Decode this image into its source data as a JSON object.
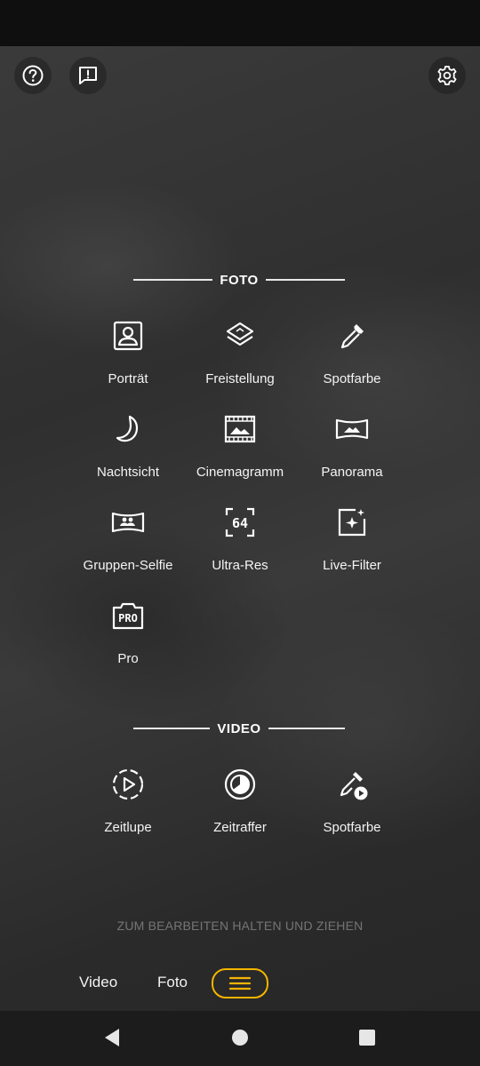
{
  "colors": {
    "accent": "#f5b400",
    "text": "#ffffff",
    "hint": "rgba(255,255,255,0.35)"
  },
  "top_bar": {
    "help_icon": "question-circle-icon",
    "feedback_icon": "feedback-icon",
    "settings_icon": "gear-icon"
  },
  "foto_section": {
    "title": "FOTO",
    "modes": [
      {
        "label": "Porträt",
        "icon": "portrait-icon"
      },
      {
        "label": "Freistellung",
        "icon": "layers-cutout-icon"
      },
      {
        "label": "Spotfarbe",
        "icon": "eyedropper-icon"
      },
      {
        "label": "Nachtsicht",
        "icon": "moon-icon"
      },
      {
        "label": "Cinemagramm",
        "icon": "film-icon"
      },
      {
        "label": "Panorama",
        "icon": "panorama-icon"
      },
      {
        "label": "Gruppen-Selfie",
        "icon": "group-selfie-icon"
      },
      {
        "label": "Ultra-Res",
        "icon": "ultra-res-64-icon"
      },
      {
        "label": "Live-Filter",
        "icon": "live-filter-icon"
      },
      {
        "label": "Pro",
        "icon": "pro-icon"
      }
    ]
  },
  "video_section": {
    "title": "VIDEO",
    "modes": [
      {
        "label": "Zeitlupe",
        "icon": "slow-motion-icon"
      },
      {
        "label": "Zeitraffer",
        "icon": "timelapse-icon"
      },
      {
        "label": "Spotfarbe",
        "icon": "eyedropper-video-icon"
      }
    ]
  },
  "hint_text": "ZUM BEARBEITEN HALTEN UND ZIEHEN",
  "bottom_tabs": {
    "video": "Video",
    "foto": "Foto",
    "menu_icon": "menu-icon"
  },
  "nav": {
    "back_icon": "back-icon",
    "home_icon": "home-icon",
    "recents_icon": "recents-icon"
  }
}
